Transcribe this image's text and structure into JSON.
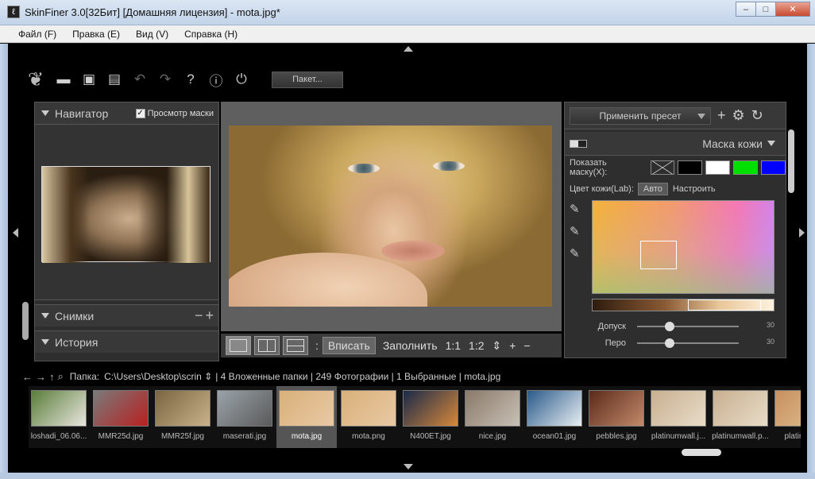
{
  "window": {
    "title": "SkinFiner 3.0[32Бит] [Домашняя лицензия] - mota.jpg*",
    "minimize": "‒",
    "maximize": "□",
    "close": "✕"
  },
  "menu": [
    "Файл (F)",
    "Правка (E)",
    "Вид (V)",
    "Справка (H)"
  ],
  "toolbar": {
    "batch_label": "Пакет..."
  },
  "navigator": {
    "title": "Навигатор",
    "mask_preview": "Просмотр маски"
  },
  "snapshots": {
    "title": "Снимки"
  },
  "history": {
    "title": "История"
  },
  "viewbar": {
    "fit": "Вписать",
    "fill": "Заполнить",
    "ratio_1_1": "1:1",
    "ratio_1_2": "1:2",
    "zoom_in": "+",
    "zoom_out": "−"
  },
  "right": {
    "preset_button": "Применить пресет",
    "mask_title": "Маска кожи",
    "show_mask": "Показать маску(X):",
    "skin_color": "Цвет кожи(Lab):",
    "skin_auto": "Авто",
    "skin_adjust": "Настроить",
    "sliders": [
      {
        "label": "Допуск",
        "value": "30",
        "level": 0.3
      },
      {
        "label": "Перо",
        "value": "30",
        "level": 0.3
      }
    ],
    "swatches": [
      "#000000",
      "#ffffff",
      "#00e000",
      "#0000ff"
    ]
  },
  "pathbar": {
    "label": "Папка:",
    "path": "C:\\Users\\Desktop\\scrin ⇕",
    "info": "| 4 Вложенные папки | 249 Фотографии | 1 Выбранные | mota.jpg"
  },
  "filmstrip": [
    {
      "label": "loshadi_06.06...",
      "colors": [
        "#5a7d3a",
        "#e8e6de"
      ]
    },
    {
      "label": "MMR25d.jpg",
      "colors": [
        "#7a7a7a",
        "#b82020"
      ]
    },
    {
      "label": "MMR25f.jpg",
      "colors": [
        "#7a6540",
        "#c9b28a"
      ]
    },
    {
      "label": "maserati.jpg",
      "colors": [
        "#9aa3aa",
        "#5a5a5a"
      ]
    },
    {
      "label": "mota.jpg",
      "colors": [
        "#d8b07a",
        "#e9c9a4"
      ]
    },
    {
      "label": "mota.png",
      "colors": [
        "#d8b07a",
        "#e9c9a4"
      ]
    },
    {
      "label": "N400ET.jpg",
      "colors": [
        "#1a2a4a",
        "#d7883a"
      ]
    },
    {
      "label": "nice.jpg",
      "colors": [
        "#8a7a6a",
        "#c8c0b5"
      ]
    },
    {
      "label": "ocean01.jpg",
      "colors": [
        "#2a5a8a",
        "#e8eef2"
      ]
    },
    {
      "label": "pebbles.jpg",
      "colors": [
        "#5a2a1a",
        "#c38a6a"
      ]
    },
    {
      "label": "platinumwall.j...",
      "colors": [
        "#c8b090",
        "#e8dcc8"
      ]
    },
    {
      "label": "platinumwall.p...",
      "colors": [
        "#c8b090",
        "#e8dcc8"
      ]
    },
    {
      "label": "platinumw",
      "colors": [
        "#c89060",
        "#e0c090"
      ]
    }
  ]
}
